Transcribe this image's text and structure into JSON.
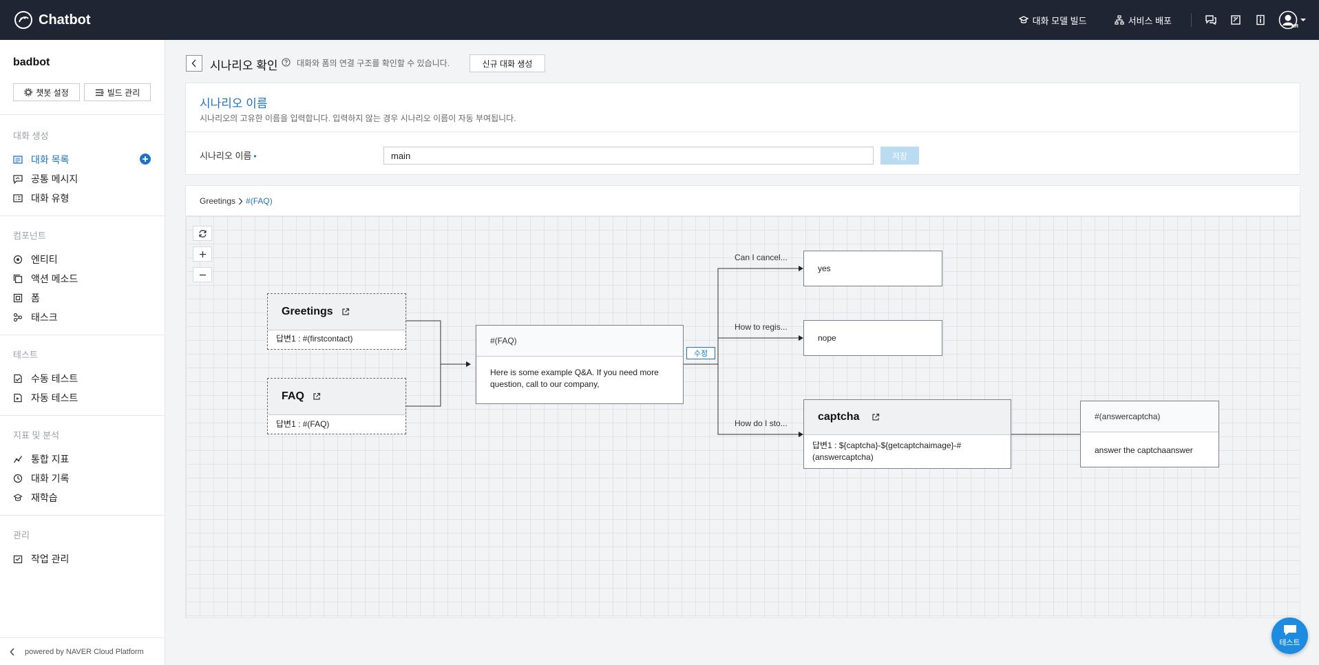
{
  "app": {
    "title": "Chatbot"
  },
  "topbar": {
    "build_label": "대화 모델 빌드",
    "deploy_label": "서비스 배포",
    "avatar_locale": "KR"
  },
  "sidebar": {
    "bot_name": "badbot",
    "chatbot_settings": "챗봇 설정",
    "build_manage": "빌드 관리",
    "sections": {
      "create": "대화 생성",
      "components": "컴포넌트",
      "test": "테스트",
      "analytics": "지표 및 분석",
      "manage": "관리"
    },
    "items": {
      "dialog_list": "대화 목록",
      "common_message": "공통 메시지",
      "dialog_type": "대화 유형",
      "entity": "엔티티",
      "action_method": "액션 메소드",
      "form": "폼",
      "task": "태스크",
      "manual_test": "수동 테스트",
      "auto_test": "자동 테스트",
      "integrated_metrics": "통합 지표",
      "dialog_history": "대화 기록",
      "retraining": "재학습",
      "job_manage": "작업 관리"
    },
    "powered_by": "powered by NAVER Cloud Platform"
  },
  "header": {
    "title": "시나리오 확인",
    "description": "대화와 폼의 연결 구조를 확인할 수 있습니다.",
    "new_dialog_button": "신규 대화 생성"
  },
  "scenario": {
    "section_title": "시나리오 이름",
    "section_desc": "시나리오의 고유한 이름을 입력합니다. 입력하지 않는 경우 시나리오 이름이 자동 부여됩니다.",
    "field_label": "시나리오 이름",
    "required_mark": "•",
    "value": "main",
    "save_button": "저장"
  },
  "breadcrumb": {
    "root": "Greetings",
    "current": "#(FAQ)"
  },
  "diagram": {
    "greetings": {
      "title": "Greetings",
      "answer": "답변1 : #(firstcontact)"
    },
    "faq": {
      "title": "FAQ",
      "answer": "답변1 : #(FAQ)"
    },
    "faq_message": {
      "header": "#(FAQ)",
      "body": "Here is some example Q&A. If you need more question, call to our company,"
    },
    "edit_badge": "수정",
    "edge_labels": {
      "cancel": "Can I cancel...",
      "register": "How to regis...",
      "stop": "How do I sto..."
    },
    "yes_node": "yes",
    "nope_node": "nope",
    "captcha": {
      "title": "captcha",
      "answer": "답변1 : ${captcha}-${getcaptchaimage}-#(answercaptcha)"
    },
    "answercaptcha": {
      "header": "#(answercaptcha)",
      "body": "answer the captchaanswer"
    }
  },
  "test_button": "테스트"
}
